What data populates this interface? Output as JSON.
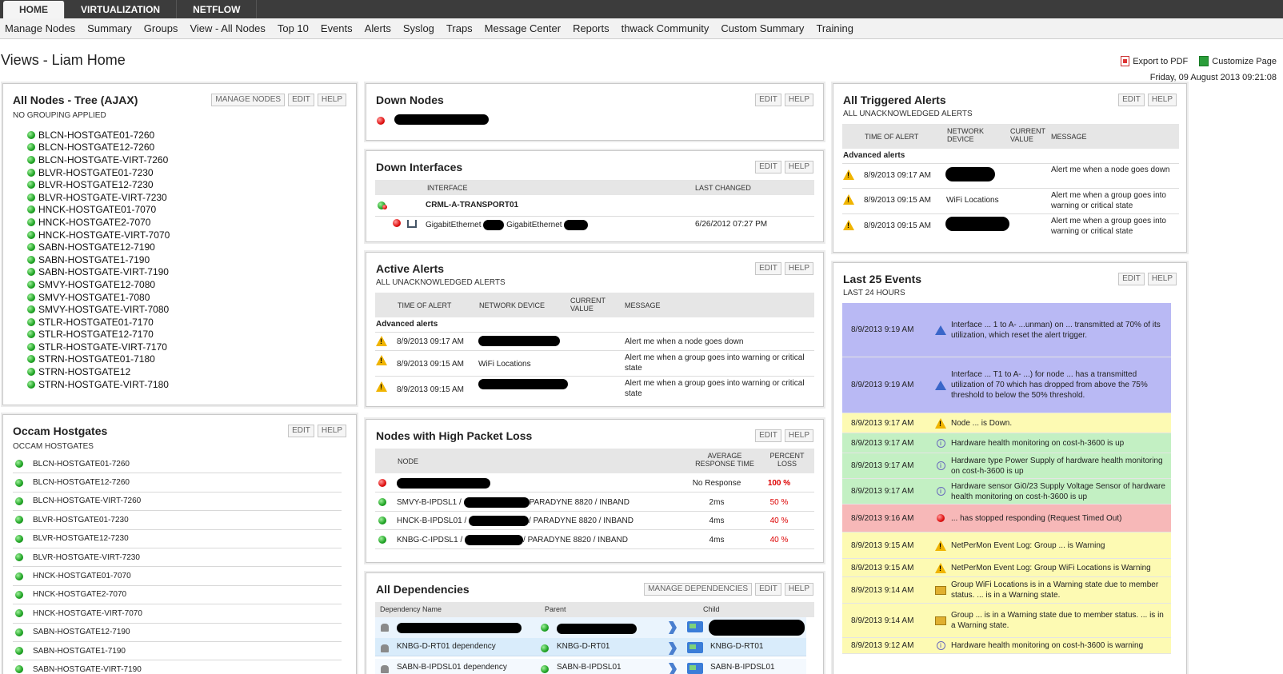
{
  "top_tabs": [
    "HOME",
    "VIRTUALIZATION",
    "NETFLOW"
  ],
  "menu": [
    "Manage Nodes",
    "Summary",
    "Groups",
    "View - All Nodes",
    "Top 10",
    "Events",
    "Alerts",
    "Syslog",
    "Traps",
    "Message Center",
    "Reports",
    "thwack Community",
    "Custom Summary",
    "Training"
  ],
  "page": {
    "title": "Views - Liam Home",
    "export_pdf": "Export to PDF",
    "customize": "Customize Page",
    "date": "Friday, 09 August 2013 09:21:08"
  },
  "buttons": {
    "manage_nodes": "MANAGE NODES",
    "edit": "EDIT",
    "help": "HELP",
    "manage_dependencies": "MANAGE DEPENDENCIES"
  },
  "all_nodes": {
    "title": "All Nodes - Tree (AJAX)",
    "subtitle": "NO GROUPING APPLIED",
    "nodes": [
      "BLCN-HOSTGATE01-7260",
      "BLCN-HOSTGATE12-7260",
      "BLCN-HOSTGATE-VIRT-7260",
      "BLVR-HOSTGATE01-7230",
      "BLVR-HOSTGATE12-7230",
      "BLVR-HOSTGATE-VIRT-7230",
      "HNCK-HOSTGATE01-7070",
      "HNCK-HOSTGATE2-7070",
      "HNCK-HOSTGATE-VIRT-7070",
      "SABN-HOSTGATE12-7190",
      "SABN-HOSTGATE1-7190",
      "SABN-HOSTGATE-VIRT-7190",
      "SMVY-HOSTGATE12-7080",
      "SMVY-HOSTGATE1-7080",
      "SMVY-HOSTGATE-VIRT-7080",
      "STLR-HOSTGATE01-7170",
      "STLR-HOSTGATE12-7170",
      "STLR-HOSTGATE-VIRT-7170",
      "STRN-HOSTGATE01-7180",
      "STRN-HOSTGATE12",
      "STRN-HOSTGATE-VIRT-7180"
    ]
  },
  "occam": {
    "title": "Occam Hostgates",
    "subtitle": "OCCAM HOSTGATES",
    "nodes": [
      "BLCN-HOSTGATE01-7260",
      "BLCN-HOSTGATE12-7260",
      "BLCN-HOSTGATE-VIRT-7260",
      "BLVR-HOSTGATE01-7230",
      "BLVR-HOSTGATE12-7230",
      "BLVR-HOSTGATE-VIRT-7230",
      "HNCK-HOSTGATE01-7070",
      "HNCK-HOSTGATE2-7070",
      "HNCK-HOSTGATE-VIRT-7070",
      "SABN-HOSTGATE12-7190",
      "SABN-HOSTGATE1-7190",
      "SABN-HOSTGATE-VIRT-7190"
    ]
  },
  "down_nodes": {
    "title": "Down Nodes"
  },
  "down_interfaces": {
    "title": "Down Interfaces",
    "col_interface": "INTERFACE",
    "col_last_changed": "LAST CHANGED",
    "node": "CRML-A-TRANSPORT01",
    "iface_a": "GigabitEthernet",
    "iface_b": "GigabitEthernet",
    "last_changed": "6/26/2012 07:27 PM"
  },
  "active_alerts": {
    "title": "Active Alerts",
    "subtitle": "ALL UNACKNOWLEDGED ALERTS",
    "cols": [
      "TIME OF ALERT",
      "NETWORK DEVICE",
      "CURRENT VALUE",
      "MESSAGE"
    ],
    "group": "Advanced alerts",
    "rows": [
      {
        "time": "8/9/2013 09:17 AM",
        "device": "",
        "message": "Alert me when a node goes down"
      },
      {
        "time": "8/9/2013 09:15 AM",
        "device": "WiFi Locations",
        "message": "Alert me when a group goes into warning or critical state"
      },
      {
        "time": "8/9/2013 09:15 AM",
        "device": "",
        "message": "Alert me when a group goes into warning or critical state"
      }
    ]
  },
  "packet_loss": {
    "title": "Nodes with High Packet Loss",
    "cols": [
      "NODE",
      "AVERAGE RESPONSE TIME",
      "PERCENT LOSS"
    ],
    "rows": [
      {
        "node_pre": "",
        "node_post": "",
        "resp": "No Response",
        "loss": "100 %",
        "status": "red"
      },
      {
        "node_pre": "SMVY-B-IPDSL1 /",
        "node_post": "PARADYNE 8820 / INBAND",
        "resp": "2ms",
        "loss": "50 %",
        "status": "green"
      },
      {
        "node_pre": "HNCK-B-IPDSL01 /",
        "node_post": "/ PARADYNE 8820 / INBAND",
        "resp": "4ms",
        "loss": "40 %",
        "status": "green"
      },
      {
        "node_pre": "KNBG-C-IPDSL1 /",
        "node_post": "/ PARADYNE 8820 / INBAND",
        "resp": "4ms",
        "loss": "40 %",
        "status": "green"
      }
    ]
  },
  "dependencies": {
    "title": "All Dependencies",
    "cols": [
      "Dependency Name",
      "Parent",
      "Child"
    ],
    "rows": [
      {
        "name": "",
        "parent": "",
        "child": ""
      },
      {
        "name": "KNBG-D-RT01 dependency",
        "parent": "KNBG-D-RT01",
        "child": "KNBG-D-RT01"
      },
      {
        "name": "SABN-B-IPDSL01 dependency",
        "parent": "SABN-B-IPDSL01",
        "child": "SABN-B-IPDSL01"
      }
    ]
  },
  "triggered_alerts": {
    "title": "All Triggered Alerts",
    "subtitle": "ALL UNACKNOWLEDGED ALERTS",
    "cols": [
      "TIME OF ALERT",
      "NETWORK DEVICE",
      "CURRENT VALUE",
      "MESSAGE"
    ],
    "group": "Advanced alerts",
    "rows": [
      {
        "time": "8/9/2013 09:17 AM",
        "device": "",
        "message": "Alert me when a node goes down"
      },
      {
        "time": "8/9/2013 09:15 AM",
        "device": "WiFi Locations",
        "message": "Alert me when a group goes into warning or critical state"
      },
      {
        "time": "8/9/2013 09:15 AM",
        "device": "",
        "message": "Alert me when a group goes into warning or critical state"
      }
    ]
  },
  "events": {
    "title": "Last 25 Events",
    "subtitle": "LAST 24 HOURS",
    "colors": {
      "blue": "#b9b9f4",
      "yellow": "#fdfab3",
      "green": "#c3f0c3",
      "red": "#f7b8b8"
    },
    "rows": [
      {
        "time": "8/9/2013 9:19 AM",
        "icon": "triangle-blue-icon",
        "color": "blue",
        "message": "Interface ... 1 to A- ...unman) on ... transmitted at 70% of its utilization, which reset the alert trigger."
      },
      {
        "time": "8/9/2013 9:19 AM",
        "icon": "triangle-blue-icon",
        "color": "blue",
        "message": "Interface ... T1 to A- ...) for node ... has a transmitted utilization of 70 which has dropped from above the 75% threshold to below the 50% threshold."
      },
      {
        "time": "8/9/2013 9:17 AM",
        "icon": "warning-icon",
        "color": "yellow",
        "message": "Node ... is Down."
      },
      {
        "time": "8/9/2013 9:17 AM",
        "icon": "info-icon",
        "color": "green",
        "message": "Hardware health monitoring on cost-h-3600 is up"
      },
      {
        "time": "8/9/2013 9:17 AM",
        "icon": "info-icon",
        "color": "green",
        "message": "Hardware type Power Supply of hardware health monitoring on cost-h-3600 is up"
      },
      {
        "time": "8/9/2013 9:17 AM",
        "icon": "info-icon",
        "color": "green",
        "message": "Hardware sensor Gi0/23 Supply Voltage Sensor of hardware health monitoring on cost-h-3600 is up"
      },
      {
        "time": "8/9/2013 9:16 AM",
        "icon": "red-dot-icon",
        "color": "red",
        "message": "... has stopped responding (Request Timed Out)"
      },
      {
        "time": "8/9/2013 9:15 AM",
        "icon": "warning-icon",
        "color": "yellow",
        "message": "NetPerMon Event Log: Group ... is Warning"
      },
      {
        "time": "8/9/2013 9:15 AM",
        "icon": "warning-icon",
        "color": "yellow",
        "message": "NetPerMon Event Log: Group WiFi Locations is Warning"
      },
      {
        "time": "8/9/2013 9:14 AM",
        "icon": "folder-icon",
        "color": "yellow",
        "message": "Group WiFi Locations is in a Warning state due to member status. ... is in a Warning state."
      },
      {
        "time": "8/9/2013 9:14 AM",
        "icon": "folder-icon",
        "color": "yellow",
        "message": "Group ... is in a Warning state due to member status. ... is in a Warning state."
      },
      {
        "time": "8/9/2013 9:12 AM",
        "icon": "info-icon",
        "color": "yellow",
        "message": "Hardware health monitoring on cost-h-3600 is warning"
      }
    ]
  }
}
